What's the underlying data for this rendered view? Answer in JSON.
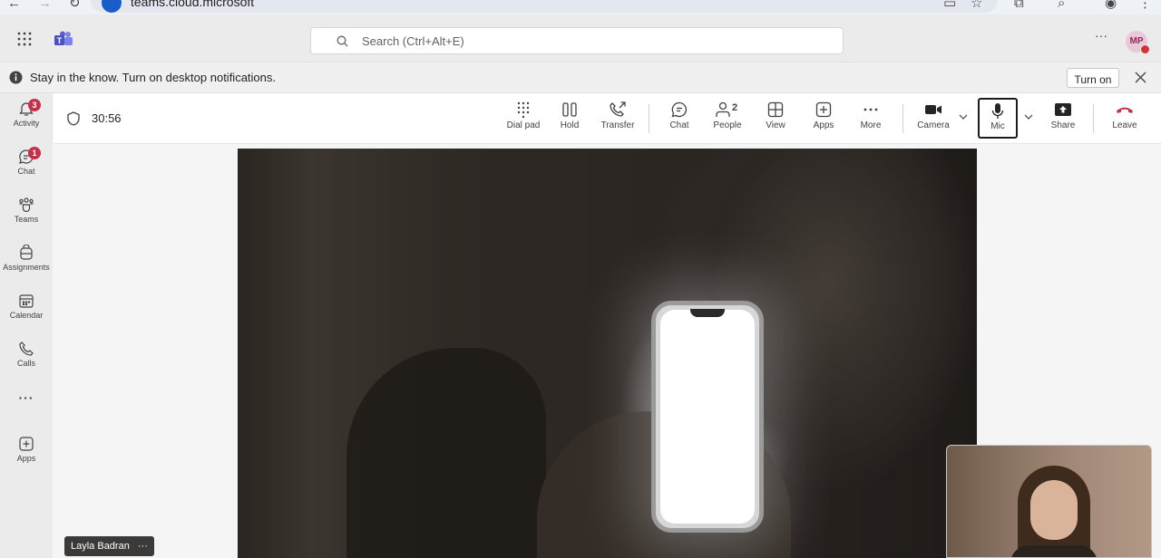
{
  "browser": {
    "url": "teams.cloud.microsoft"
  },
  "header": {
    "search_placeholder": "Search (Ctrl+Alt+E)",
    "more_label": "···",
    "avatar_initials": "MP"
  },
  "notification": {
    "text": "Stay in the know. Turn on desktop notifications.",
    "turn_on_label": "Turn on"
  },
  "rail": {
    "items": [
      {
        "label": "Activity",
        "badge": "3"
      },
      {
        "label": "Chat",
        "badge": "1"
      },
      {
        "label": "Teams"
      },
      {
        "label": "Assignments"
      },
      {
        "label": "Calendar"
      },
      {
        "label": "Calls"
      },
      {
        "label": "···"
      },
      {
        "label": "Apps"
      }
    ]
  },
  "meeting": {
    "timer": "30:56",
    "toolbar": {
      "dial_pad": "Dial pad",
      "hold": "Hold",
      "transfer": "Transfer",
      "chat": "Chat",
      "people": "People",
      "people_count": "2",
      "view": "View",
      "apps": "Apps",
      "more": "More",
      "camera": "Camera",
      "mic": "Mic",
      "share": "Share",
      "leave": "Leave"
    },
    "participant_name": "Layla Badran",
    "participant_more": "···"
  },
  "colors": {
    "leave": "#c4314b",
    "badge": "#c4314b",
    "teams_brand": "#5b5fc7"
  }
}
